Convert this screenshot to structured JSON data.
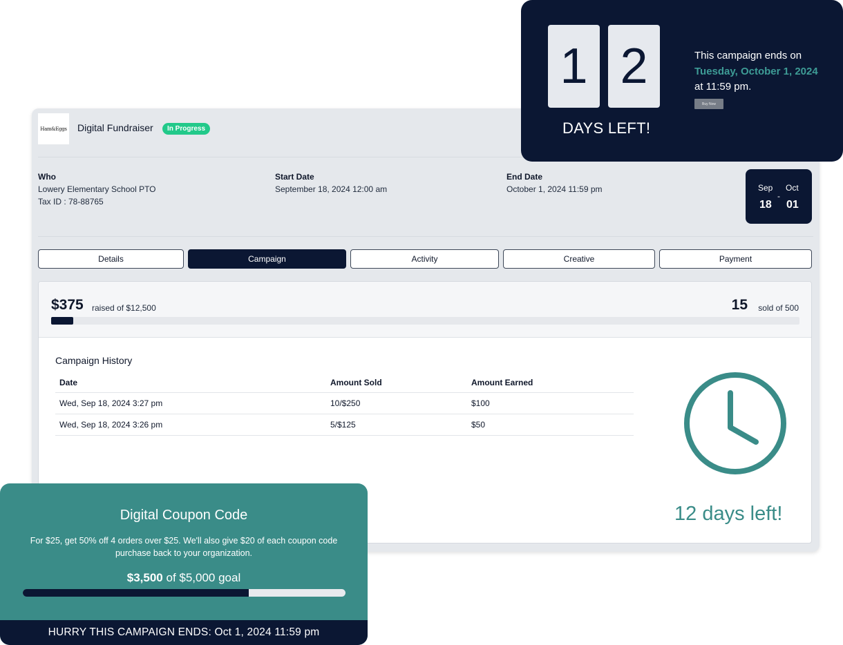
{
  "header": {
    "logo_text": "Ham&Eggs",
    "title": "Digital Fundraiser",
    "status": "In Progress"
  },
  "info": {
    "who_label": "Who",
    "who_name": "Lowery Elementary School PTO",
    "tax_id": "Tax ID : 78-88765",
    "start_label": "Start Date",
    "start_value": "September 18, 2024 12:00 am",
    "end_label": "End Date",
    "end_value": "October 1, 2024 11:59 pm"
  },
  "date_range": {
    "start_month": "Sep",
    "start_day": "18",
    "separator": "-",
    "end_month": "Oct",
    "end_day": "01"
  },
  "tabs": [
    {
      "label": "Details",
      "active": false
    },
    {
      "label": "Campaign",
      "active": true
    },
    {
      "label": "Activity",
      "active": false
    },
    {
      "label": "Creative",
      "active": false
    },
    {
      "label": "Payment",
      "active": false
    }
  ],
  "progress": {
    "raised": "$375",
    "raised_label": "raised of $12,500",
    "sold": "15",
    "sold_label": "sold of 500",
    "fraction": 0.03
  },
  "history": {
    "title": "Campaign History",
    "columns": [
      "Date",
      "Amount Sold",
      "Amount Earned"
    ],
    "rows": [
      [
        "Wed, Sep 18, 2024 3:27 pm",
        "10/$250",
        "$100"
      ],
      [
        "Wed, Sep 18, 2024 3:26 pm",
        "5/$125",
        "$50"
      ]
    ]
  },
  "clock": {
    "icon": "clock-icon",
    "days_left_text": "12 days left!",
    "color": "#3a8c88"
  },
  "countdown": {
    "digits": [
      "1",
      "2"
    ],
    "label": "DAYS LEFT!",
    "ends_prefix": "This campaign ends on",
    "ends_date": "Tuesday, October 1, 2024",
    "ends_time": "at 11:59 pm.",
    "button": "Buy Now"
  },
  "coupon": {
    "title": "Digital Coupon Code",
    "description": "For $25, get 50% off 4 orders over $25.  We'll also give $20 of each coupon code purchase back to your organization.",
    "goal_amount": "$3,500",
    "goal_suffix": "of $5,000 goal",
    "fraction": 0.7,
    "footer": "HURRY THIS CAMPAIGN ENDS: Oct 1, 2024 11:59 pm"
  },
  "colors": {
    "navy": "#0b1733",
    "teal": "#3a8c88",
    "badge_green": "#22c98a"
  }
}
